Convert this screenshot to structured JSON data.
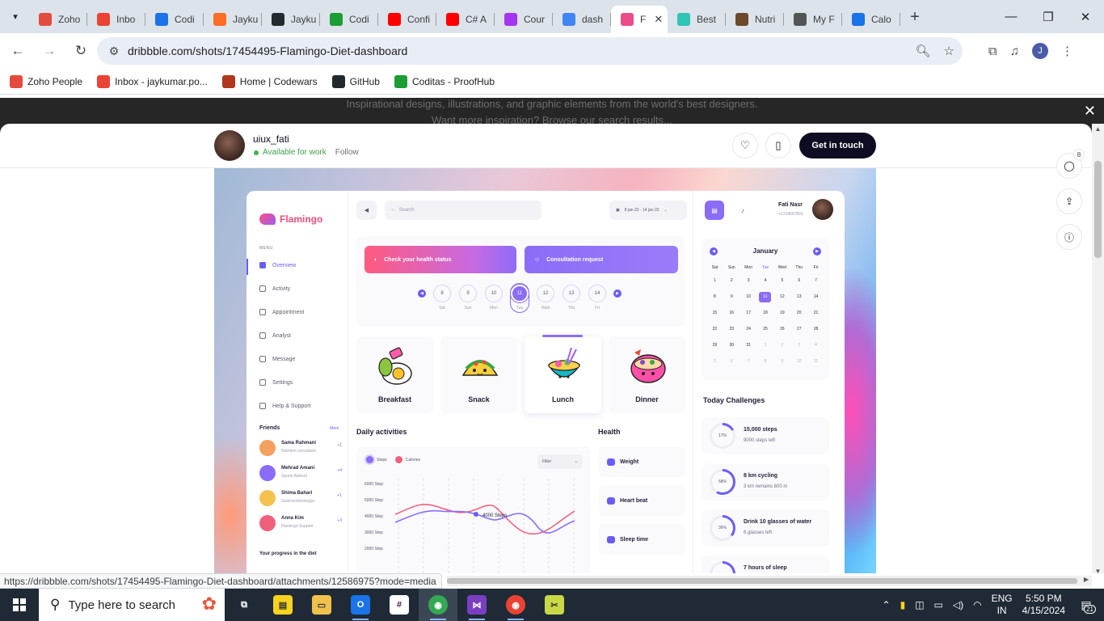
{
  "browser": {
    "tabs": [
      {
        "label": "Zoho",
        "icon": "zoho-people-icon",
        "color": "#e34b3f"
      },
      {
        "label": "Inbo",
        "icon": "gmail-icon",
        "color": "#ea4335"
      },
      {
        "label": "Codi",
        "icon": "calendar-15-icon",
        "color": "#1a73e8"
      },
      {
        "label": "Jayku",
        "icon": "gitlab-icon",
        "color": "#fc6d26"
      },
      {
        "label": "Jayku",
        "icon": "github-icon",
        "color": "#24292e"
      },
      {
        "label": "Codi",
        "icon": "proofhub-icon",
        "color": "#1c9c35"
      },
      {
        "label": "Confi",
        "icon": "youtube-icon",
        "color": "#ff0000"
      },
      {
        "label": "C# A",
        "icon": "youtube-icon",
        "color": "#ff0000"
      },
      {
        "label": "Cour",
        "icon": "udemy-icon",
        "color": "#a435f0"
      },
      {
        "label": "dash",
        "icon": "google-icon",
        "color": "#4285f4"
      },
      {
        "label": "F",
        "icon": "dribbble-icon",
        "color": "#ea4c89",
        "active": true
      },
      {
        "label": "Best",
        "icon": "diamond-icon",
        "color": "#2ec4b6"
      },
      {
        "label": "Nutri",
        "icon": "nutrition-icon",
        "color": "#6b4a2b"
      },
      {
        "label": "My F",
        "icon": "stopwatch-icon",
        "color": "#555555"
      },
      {
        "label": "Calo",
        "icon": "calorie-icon",
        "color": "#1a73e8"
      }
    ],
    "url": "dribbble.com/shots/17454495-Flamingo-Diet-dashboard",
    "bookmarks": [
      {
        "label": "Zoho People",
        "icon": "zoho-people-icon"
      },
      {
        "label": "Inbox - jaykumar.po...",
        "icon": "gmail-icon"
      },
      {
        "label": "Home | Codewars",
        "icon": "codewars-icon"
      },
      {
        "label": "GitHub",
        "icon": "github-icon"
      },
      {
        "label": "Coditas - ProofHub",
        "icon": "proofhub-icon"
      }
    ],
    "status_url": "https://dribbble.com/shots/17454495-Flamingo-Diet-dashboard/attachments/12586975?mode=media"
  },
  "overlay": {
    "line1": "Inspirational designs, illustrations, and graphic elements from the world's best designers.",
    "line2": "Want more inspiration? Browse our search results..."
  },
  "shot": {
    "author": "uiux_fati",
    "availability": "Available for work",
    "follow": "Follow",
    "cta": "Get in touch",
    "comments_count": "8"
  },
  "dashboard": {
    "brand": "Flamingo",
    "menu_caption": "MENU",
    "menu": [
      "Overview",
      "Activity",
      "Appointment",
      "Analyst",
      "Message",
      "Settings",
      "Help & Support"
    ],
    "friends_caption": "Friends",
    "friends_more": "More",
    "friends": [
      {
        "name": "Sama Rahmani",
        "role": "Nutrition consultant",
        "plus": "+1",
        "color": "#f2a15f"
      },
      {
        "name": "Mehrad Amani",
        "role": "Sports Advisor",
        "plus": "+4",
        "color": "#8b6cf7"
      },
      {
        "name": "Shima Bahari",
        "role": "Gastroenterologist",
        "plus": "+1",
        "color": "#f5c24f"
      },
      {
        "name": "Anna Kim",
        "role": "Flamingo Support",
        "plus": "+3",
        "color": "#f0607d"
      }
    ],
    "progress_caption": "Your progress in the diet",
    "search_placeholder": "Search",
    "date_range": "8 jan 22 - 14 jan 22",
    "user_name": "Fati Nasr",
    "user_phone": "+1234567891",
    "health_status_btn": "Check your health status",
    "consultation_btn": "Consultation request",
    "dates": [
      {
        "num": "8",
        "day": "Sat"
      },
      {
        "num": "9",
        "day": "Sun"
      },
      {
        "num": "10",
        "day": "Mon"
      },
      {
        "num": "11",
        "day": "Tue",
        "selected": true
      },
      {
        "num": "12",
        "day": "Wed"
      },
      {
        "num": "13",
        "day": "Thu"
      },
      {
        "num": "14",
        "day": "Fri"
      }
    ],
    "meals": [
      "Breakfast",
      "Snack",
      "Lunch",
      "Dinner"
    ],
    "daily_caption": "Daily activities",
    "legend": [
      "Steps",
      "Calories"
    ],
    "filter": "Filter",
    "y_ticks": [
      "6000 Step",
      "5000 Step",
      "4000 Step",
      "3000 Step",
      "2000 Step"
    ],
    "tooltip": "4000 Steps",
    "health_caption": "Health",
    "health_items": [
      "Weight",
      "Heart beat",
      "Sleep time"
    ],
    "calendar_month": "January",
    "weekdays": [
      "Sat",
      "Sun",
      "Mon",
      "Tue",
      "Wed",
      "Thu",
      "Fri"
    ],
    "calendar_days": [
      "1",
      "2",
      "3",
      "4",
      "5",
      "6",
      "7",
      "8",
      "9",
      "10",
      "11",
      "12",
      "13",
      "14",
      "15",
      "16",
      "17",
      "18",
      "19",
      "20",
      "21",
      "22",
      "23",
      "24",
      "25",
      "26",
      "27",
      "28",
      "29",
      "30",
      "31",
      "1",
      "2",
      "3",
      "4",
      "5",
      "6",
      "7",
      "8",
      "9",
      "10",
      "11"
    ],
    "calendar_selected": "11",
    "challenges_caption": "Today Challenges",
    "challenges": [
      {
        "title": "15,000 steps",
        "sub": "9000 steps left",
        "pct": "17%",
        "value": 17
      },
      {
        "title": "8 km cycling",
        "sub": "3 km remains 600 m",
        "pct": "58%",
        "value": 58
      },
      {
        "title": "Drink 10 glasses of water",
        "sub": "6 glasses left",
        "pct": "36%",
        "value": 36
      },
      {
        "title": "7 hours of sleep",
        "sub": "",
        "pct": "",
        "value": 60
      }
    ]
  },
  "taskbar": {
    "search_placeholder": "Type here to search",
    "lang1": "ENG",
    "lang2": "IN",
    "time": "5:50 PM",
    "date": "4/15/2024",
    "notifications": "21"
  }
}
